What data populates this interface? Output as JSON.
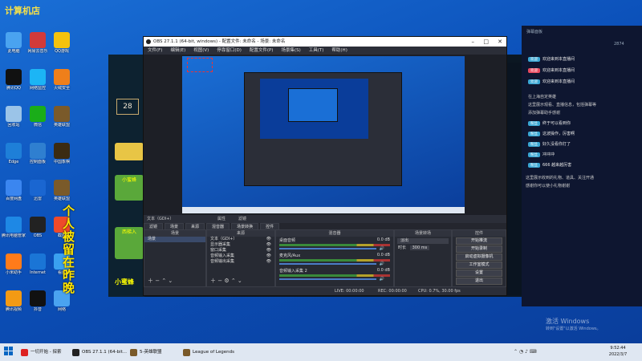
{
  "desktop_logo": "计算机店",
  "desktop_icons": [
    {
      "label": "此电脑",
      "color": "#4aa3f0"
    },
    {
      "label": "网易云音乐",
      "color": "#d23a3a"
    },
    {
      "label": "QQ游戏",
      "color": "#f4c20d"
    },
    {
      "label": "腾讯QQ",
      "color": "#111"
    },
    {
      "label": "网络监控",
      "color": "#1cb5f5"
    },
    {
      "label": "火绒安全",
      "color": "#ef7f1a"
    },
    {
      "label": "回收站",
      "color": "#9bc4e8"
    },
    {
      "label": "微信",
      "color": "#1aad19"
    },
    {
      "label": "英雄联盟",
      "color": "#7a5a2a"
    },
    {
      "label": "Edge",
      "color": "#1e7fd8"
    },
    {
      "label": "控制面板",
      "color": "#2f7fd0"
    },
    {
      "label": "中国象棋",
      "color": "#3b2b12"
    },
    {
      "label": "百度网盘",
      "color": "#3b86f0"
    },
    {
      "label": "迅雷",
      "color": "#1a66d1"
    },
    {
      "label": "英雄联盟",
      "color": "#7a5a2a"
    },
    {
      "label": "腾讯电脑管家",
      "color": "#1e88e5"
    },
    {
      "label": "OBS",
      "color": "#222"
    },
    {
      "label": "截图",
      "color": "#ef4a2a"
    },
    {
      "label": "小米助手",
      "color": "#ff7b1a"
    },
    {
      "label": "Internet",
      "color": "#1a75d6"
    },
    {
      "label": "看图",
      "color": "#3aa1f0"
    },
    {
      "label": "腾讯视频",
      "color": "#f39a14"
    },
    {
      "label": "抖音",
      "color": "#111"
    },
    {
      "label": "网络",
      "color": "#4aa3f0"
    }
  ],
  "overlay_text": "个人被留在昨晚",
  "game": {
    "title": "League of Legends",
    "level": "28",
    "btn1": "小蜜蜂",
    "btn2": "西梯入",
    "footer": "小蜜蜂"
  },
  "obs": {
    "title": "OBS 27.1.1 (64-bit, windows) - 配置文件: 未命名 - 场景: 未命名",
    "menus": [
      "文件(F)",
      "编辑(E)",
      "视图(V)",
      "停靠窗口(D)",
      "配置文件(P)",
      "场景集(S)",
      "工具(T)",
      "帮助(H)"
    ],
    "sourcebar": {
      "label": "文本（GDI+）",
      "props": "属性",
      "filters": "滤镜"
    },
    "tabs": [
      "滤镜",
      "场景",
      "来源",
      "混音器",
      "场景转换",
      "控件"
    ],
    "scenes_header": "场景",
    "scene_item": "场景",
    "sources_header": "来源",
    "sources": [
      "文本（GDI+）",
      "显示器采集",
      "窗口采集",
      "音频输入采集",
      "音频输出采集"
    ],
    "mixer_header": "混音器",
    "mixer": [
      {
        "name": "桌面音频",
        "db": "0.0 dB"
      },
      {
        "name": "麦克风/Aux",
        "db": "0.0 dB"
      },
      {
        "name": "音频输入采集 2",
        "db": "0.0 dB"
      }
    ],
    "transition_header": "场景转场",
    "transition": "淡出",
    "duration_label": "时长",
    "duration": "300 ms",
    "controls_header": "控件",
    "controls": [
      "开始推流",
      "开始录制",
      "启动虚拟摄像机",
      "工作室模式",
      "设置",
      "退出"
    ],
    "status": {
      "live": "LIVE: 00:00:00",
      "rec": "REC: 00:00:00",
      "cpu": "CPU: 0.7%, 30.00 fps"
    }
  },
  "chat": {
    "header": "弹幕面板",
    "count": "2874",
    "messages": [
      {
        "badge": "欢迎",
        "badge_color": "#3aa7d4",
        "text": "欢迎来到本直播间",
        "name": "用户"
      },
      {
        "badge": "欢迎",
        "badge_color": "#e84a5f",
        "text": "欢迎来到本直播间",
        "name": "用户"
      },
      {
        "badge": "欢迎",
        "badge_color": "#3aa7d4",
        "text": "欢迎来到本直播间",
        "name": "用户"
      }
    ],
    "notice": "在上海自定英雄",
    "notice2": "这里展示观看、直播信息，包括弹幕等",
    "notice3": "添加弹幕助手感谢",
    "replies": [
      {
        "badge": "粉丝",
        "badge_color": "#3aa7d4",
        "text": "终于可以看到你"
      },
      {
        "badge": "粉丝",
        "badge_color": "#3aa7d4",
        "text": "这波操作，厉害啊"
      },
      {
        "badge": "粉丝",
        "badge_color": "#3aa7d4",
        "text": "好久没看你打了"
      },
      {
        "badge": "粉丝",
        "badge_color": "#3aa7d4",
        "text": "冲冲冲"
      },
      {
        "badge": "粉丝",
        "badge_color": "#3aa7d4",
        "text": "666 越来越厉害"
      }
    ],
    "footer1": "这里展示收到的礼物、道具、关注开通",
    "footer2": "感谢你可以使小礼物谢谢"
  },
  "watermark": {
    "line1": "激活 Windows",
    "line2": "转到\"设置\"以激活 Windows。"
  },
  "taskbar": {
    "items": [
      {
        "label": "一切开始 - 探索",
        "color": "#d22"
      },
      {
        "label": "OBS 27.1.1 (64-bit...",
        "color": "#222"
      },
      {
        "label": "5-英雄联盟",
        "color": "#7a5a2a"
      },
      {
        "label": "League of Legends",
        "color": "#7a5a2a"
      }
    ],
    "time": "9:52:44",
    "date": "2022/3/7"
  }
}
